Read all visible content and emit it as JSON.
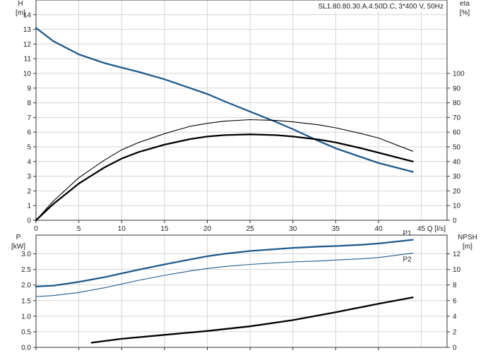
{
  "chart_data": [
    {
      "type": "line",
      "title": "SL1.80.80.30.A.4.50D.C, 3*400 V, 50Hz",
      "xlabel": "Q [l/s]",
      "xunit_label": "45 Q [l/s]",
      "xlim": [
        0,
        48
      ],
      "x_ticks": [
        0,
        5,
        10,
        15,
        20,
        25,
        30,
        35,
        40
      ],
      "ylabel_left": "H",
      "ylabel_left_unit": "[m]",
      "ylim_left": [
        0,
        15
      ],
      "y_ticks_left": [
        0,
        1,
        2,
        3,
        4,
        5,
        6,
        7,
        8,
        9,
        10,
        11,
        12,
        13,
        14
      ],
      "ylabel_right": "eta",
      "ylabel_right_unit": "[%]",
      "ylim_right": [
        0,
        150
      ],
      "y_ticks_right": [
        0,
        10,
        20,
        30,
        40,
        50,
        60,
        70,
        80,
        90,
        100
      ],
      "grid": true,
      "series": [
        {
          "axis": "left",
          "color": "#1f5a8c",
          "x": [
            0,
            2,
            5,
            8,
            10,
            12,
            15,
            18,
            20,
            22,
            25,
            28,
            30,
            33,
            35,
            38,
            40,
            44
          ],
          "y": [
            13.1,
            12.2,
            11.3,
            10.7,
            10.4,
            10.1,
            9.6,
            9.0,
            8.6,
            8.1,
            7.4,
            6.7,
            6.2,
            5.4,
            4.9,
            4.3,
            3.9,
            3.3
          ]
        },
        {
          "axis": "right",
          "color": "#000000",
          "x": [
            0,
            2,
            5,
            8,
            10,
            12,
            15,
            18,
            20,
            22,
            25,
            28,
            30,
            33,
            35,
            38,
            40,
            44
          ],
          "y": [
            0,
            11,
            25,
            36,
            42,
            46.5,
            51.5,
            55.3,
            57,
            58,
            58.5,
            58,
            57,
            55,
            53,
            49,
            46,
            40
          ]
        },
        {
          "axis": "right",
          "color": "#000000",
          "thin": true,
          "x": [
            0,
            2,
            5,
            8,
            10,
            12,
            15,
            18,
            20,
            22,
            25,
            28,
            30,
            33,
            35,
            38,
            40,
            44
          ],
          "y": [
            0,
            13,
            29,
            41,
            48,
            53,
            59,
            64,
            66,
            67.5,
            68.5,
            68,
            67,
            65,
            63,
            59,
            56,
            47
          ]
        }
      ]
    },
    {
      "type": "line",
      "xlim": [
        0,
        48
      ],
      "ylabel_left": "P",
      "ylabel_left_unit": "[kW]",
      "ylim_left": [
        0,
        3.6
      ],
      "y_ticks_left": [
        0.0,
        0.5,
        1.0,
        1.5,
        2.0,
        2.5,
        3.0
      ],
      "ylabel_right": "NPSH",
      "ylabel_right_unit": "[m]",
      "ylim_right": [
        0,
        14.4
      ],
      "y_ticks_right": [
        0,
        2,
        4,
        6,
        8,
        10,
        12
      ],
      "grid": true,
      "series": [
        {
          "name": "P1",
          "axis": "left",
          "color": "#1f5a8c",
          "x": [
            0,
            2,
            5,
            8,
            10,
            12,
            15,
            18,
            20,
            22,
            25,
            28,
            30,
            33,
            35,
            38,
            40,
            44
          ],
          "y": [
            1.95,
            1.98,
            2.1,
            2.25,
            2.37,
            2.49,
            2.66,
            2.82,
            2.92,
            3.0,
            3.09,
            3.15,
            3.19,
            3.23,
            3.25,
            3.29,
            3.33,
            3.45
          ]
        },
        {
          "name": "P2",
          "axis": "left",
          "color": "#1f5a8c",
          "thin": true,
          "x": [
            0,
            2,
            5,
            8,
            10,
            12,
            15,
            18,
            20,
            22,
            25,
            28,
            30,
            33,
            35,
            38,
            40,
            44
          ],
          "y": [
            1.63,
            1.66,
            1.76,
            1.91,
            2.03,
            2.15,
            2.31,
            2.45,
            2.53,
            2.59,
            2.66,
            2.71,
            2.74,
            2.77,
            2.8,
            2.84,
            2.88,
            3.02
          ]
        },
        {
          "axis": "right",
          "color": "#000000",
          "x": [
            6.5,
            10,
            15,
            20,
            25,
            30,
            35,
            40,
            44
          ],
          "y": [
            0.6,
            1.1,
            1.6,
            2.1,
            2.7,
            3.5,
            4.5,
            5.6,
            6.4
          ]
        }
      ]
    }
  ]
}
